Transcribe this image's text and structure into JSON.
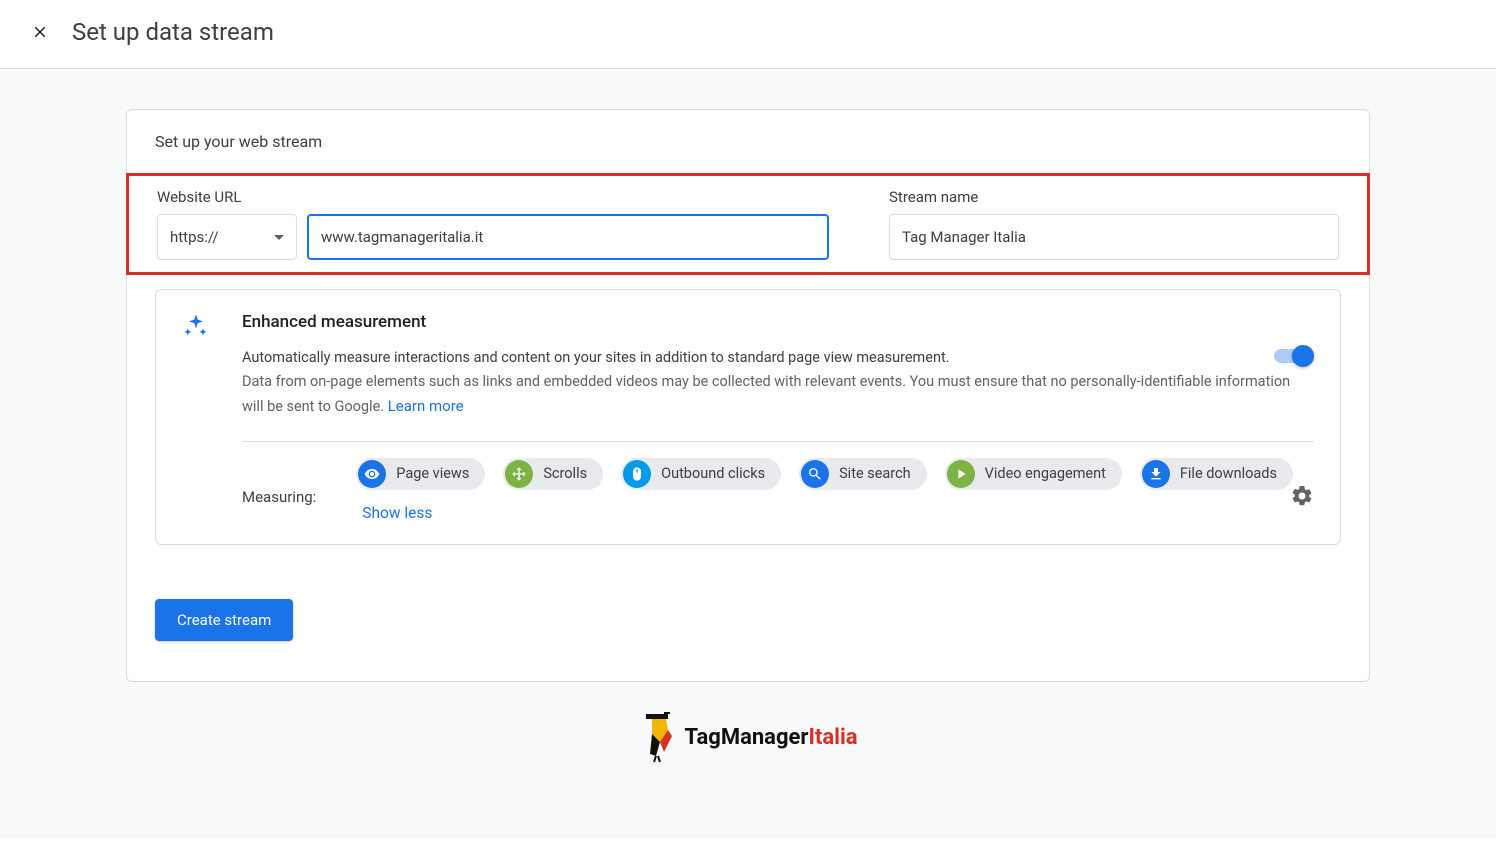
{
  "header": {
    "title": "Set up data stream"
  },
  "card": {
    "section_title": "Set up your web stream",
    "url_label": "Website URL",
    "protocol": "https://",
    "url_value": "www.tagmanageritalia.it",
    "stream_label": "Stream name",
    "stream_value": "Tag Manager Italia"
  },
  "enhanced": {
    "title": "Enhanced measurement",
    "desc1": "Automatically measure interactions and content on your sites in addition to standard page view measurement.",
    "desc2": "Data from on-page elements such as links and embedded videos may be collected with relevant events. You must ensure that no personally-identifiable information will be sent to Google.",
    "learn_more": "Learn more",
    "toggle_on": true,
    "measuring_label": "Measuring:",
    "chips": [
      {
        "icon": "eye",
        "color": "c-blue",
        "label": "Page views"
      },
      {
        "icon": "scroll",
        "color": "c-green",
        "label": "Scrolls"
      },
      {
        "icon": "mouse",
        "color": "c-lblue",
        "label": "Outbound clicks"
      },
      {
        "icon": "search",
        "color": "c-blue",
        "label": "Site search"
      },
      {
        "icon": "play",
        "color": "c-green",
        "label": "Video engagement"
      },
      {
        "icon": "download",
        "color": "c-blue",
        "label": "File downloads"
      }
    ],
    "show_less": "Show less"
  },
  "create_button": "Create stream",
  "footer": {
    "brand1": "TagManager",
    "brand2": "Italia"
  }
}
